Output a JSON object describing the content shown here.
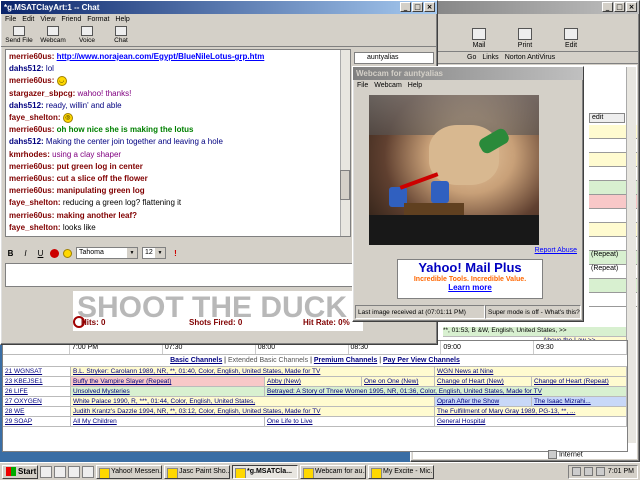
{
  "chat": {
    "title": "*g.MSATClayArt:1 -- Chat",
    "menu": [
      "File",
      "Edit",
      "View",
      "Friend",
      "Format",
      "Help"
    ],
    "tools": [
      "Send File",
      "Webcam",
      "Voice",
      "Chat"
    ],
    "messages": [
      {
        "nick": "merrie60us:",
        "text": "http://www.norajean.com/Egypt/BlueNileLotus-grp.htm",
        "style": "link",
        "nick_color": "nr"
      },
      {
        "nick": "dahs512:",
        "text": "lol",
        "style": "t-blue",
        "nick_color": "nb"
      },
      {
        "nick": "merrie60us:",
        "text": "",
        "emoticon": "smile",
        "style": "t-red",
        "nick_color": "nr"
      },
      {
        "nick": "stargazer_sbpcg:",
        "text": "wahoo! thanks!",
        "style": "t-purple",
        "nick_color": "nr"
      },
      {
        "nick": "dahs512:",
        "text": "ready, willin' and able",
        "style": "t-blue",
        "nick_color": "nb"
      },
      {
        "nick": "faye_shelton:",
        "text": "",
        "emoticon": "hug",
        "style": "t-plain",
        "nick_color": "nr"
      },
      {
        "nick": "merrie60us:",
        "text": "oh how nice she is making the lotus",
        "style": "t-green",
        "nick_color": "nr"
      },
      {
        "nick": "dahs512:",
        "text": "Making the center join together and leaving a hole",
        "style": "t-blue",
        "nick_color": "nb"
      },
      {
        "nick": "kmrhodes:",
        "text": "using a clay shaper",
        "style": "t-purple",
        "nick_color": "nr"
      },
      {
        "nick": "merrie60us:",
        "text": "put green log in center",
        "style": "t-red",
        "nick_color": "nr"
      },
      {
        "nick": "merrie60us:",
        "text": "cut a slice off the flower",
        "style": "t-red",
        "nick_color": "nr"
      },
      {
        "nick": "merrie60us:",
        "text": "manipulating green log",
        "style": "t-red",
        "nick_color": "nr"
      },
      {
        "nick": "faye_shelton:",
        "text": "reducing a green log? flattening it",
        "style": "t-plain",
        "nick_color": "nr"
      },
      {
        "nick": "merrie60us:",
        "text": "making another leaf?",
        "style": "t-red",
        "nick_color": "nr"
      },
      {
        "nick": "faye_shelton:",
        "text": "looks like",
        "style": "t-plain",
        "nick_color": "nr"
      }
    ],
    "format": {
      "font": "Tahoma",
      "size": "12",
      "bold": "B",
      "italic": "I",
      "underline": "U"
    },
    "compose_value": ""
  },
  "game": {
    "title": "SHOOT THE DUCK",
    "hits_label": "Hits: 0",
    "shots_label": "Shots Fired: 0",
    "rate_label": "Hit Rate: 0%"
  },
  "webcam": {
    "title": "Webcam for auntyalias",
    "menu": [
      "File",
      "Webcam",
      "Help"
    ],
    "report": "Report Abuse",
    "ad": {
      "title": "Yahoo! Mail Plus",
      "sub": "Incredible Tools. Incredible Value.",
      "learn": "Learn more"
    },
    "status_left": "Last image received at (07:01:11 PM)",
    "status_right": "Super mode is off - What's this?"
  },
  "browser": {
    "tools": [
      "Mail",
      "Print",
      "Edit"
    ],
    "addr_go": "Go",
    "addr_links": "Links",
    "addr_av": "Norton AntiVirus",
    "side_user": "auntyalias",
    "side_edit": "edit",
    "repeat1": "(Repeat)",
    "repeat2": "(Repeat)",
    "row_fragment": "**, 01:53, B &W, English, United States, >>",
    "above_law": "Above the Law >>",
    "status": "Internet"
  },
  "tvgrid": {
    "times": [
      "7:00 PM",
      "07:30",
      "08:00",
      "08:30",
      "09:00",
      "09:30"
    ],
    "tiers": [
      "Basic Channels",
      "Extended Basic Channels",
      "Premium Channels",
      "Pay Per View Channels"
    ],
    "rows": [
      {
        "ch": "21 WGNSAT",
        "cells": [
          {
            "t": "B.L. Stryker: Carolann 1989, NR, **, 01:40, Color, English, United States, Made for TV",
            "w": 364,
            "c": "cream"
          },
          {
            "t": "WGN News at Nine",
            "w": 192,
            "c": "cream"
          }
        ]
      },
      {
        "ch": "23 KBEJSE1",
        "cells": [
          {
            "t": "Buffy the Vampire Slayer (Repeat)",
            "w": 194,
            "c": "pink"
          },
          {
            "t": "Abby (New)",
            "w": 97,
            "c": "cream"
          },
          {
            "t": "One on One (New)",
            "w": 73,
            "c": "cream"
          },
          {
            "t": "Change of Heart (New)",
            "w": 97,
            "c": "cream"
          },
          {
            "t": "Change of Heart (Repeat)",
            "w": 95,
            "c": "cream"
          }
        ]
      },
      {
        "ch": "26 LIFE",
        "cells": [
          {
            "t": "Unsolved Mysteries",
            "w": 194,
            "c": "green"
          },
          {
            "t": "Betrayed: A Story of Three Women 1995, NR, 01:36, Color, English, United States, Made for TV",
            "w": 362,
            "c": "green"
          }
        ]
      },
      {
        "ch": "27 OXYGEN",
        "cells": [
          {
            "t": "White Palace 1990, R, ***, 01:44, Color, English, United States,",
            "w": 364,
            "c": "cream"
          },
          {
            "t": "Oprah After the Show",
            "w": 97,
            "c": "blue"
          },
          {
            "t": "The Isaac Mizrahi...",
            "w": 95,
            "c": "blue"
          }
        ]
      },
      {
        "ch": "28 WE",
        "cells": [
          {
            "t": "Judith Krantz's Dazzle 1994, NR, **, 03:12, Color, English, United States, Made for TV",
            "w": 364,
            "c": "cream"
          },
          {
            "t": "The Fulfillment of Mary Gray 1989, PG-13, **, ...",
            "w": 192,
            "c": "cream"
          }
        ]
      },
      {
        "ch": "29 SOAP",
        "cells": [
          {
            "t": "All My Children",
            "w": 194,
            "c": "white"
          },
          {
            "t": "One Life to Live",
            "w": 170,
            "c": "white"
          },
          {
            "t": "General Hospital",
            "w": 192,
            "c": "white"
          }
        ]
      }
    ]
  },
  "taskbar": {
    "start": "Start",
    "tasks": [
      "Yahoo! Messen...",
      "Jasc Paint Sho...",
      "*g.MSATCla...",
      "Webcam for au...",
      "My Excite - Mic..."
    ],
    "active_index": 2,
    "clock": "7:01 PM"
  }
}
